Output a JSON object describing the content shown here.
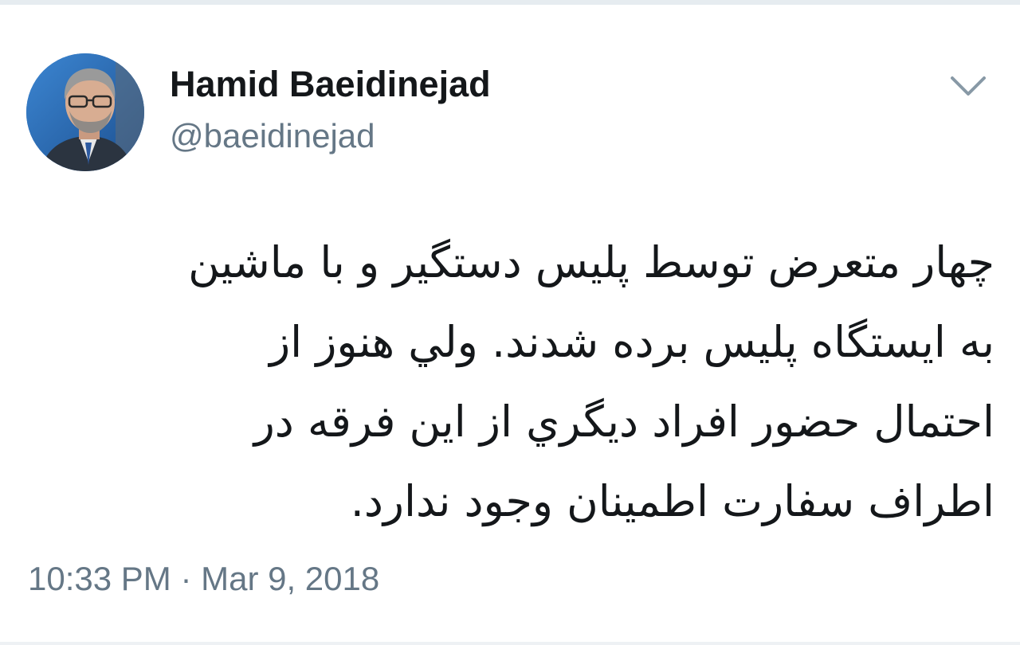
{
  "tweet": {
    "author": {
      "display_name": "Hamid Baeidinejad",
      "handle": "@baeidinejad",
      "avatar_icon": "profile-photo"
    },
    "menu_icon": "chevron-down-icon",
    "text_lines": [
      "چهار متعرض توسط پلیس دستگیر و با ماشین",
      "به ایستگاه پلیس برده شدند. ولي هنوز از",
      "احتمال حضور افراد دیگري از این فرقه در",
      "اطراف سفارت اطمینان وجود ندارد."
    ],
    "timestamp": "10:33 PM · Mar 9, 2018"
  },
  "colors": {
    "name_text": "#14171a",
    "secondary_text": "#657786",
    "chevron": "#8899a6",
    "border": "#e6ecf0"
  }
}
